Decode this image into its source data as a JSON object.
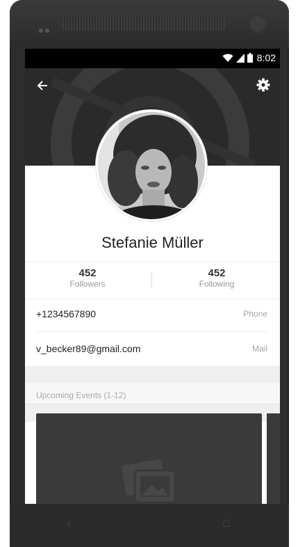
{
  "status_bar": {
    "time": "8:02"
  },
  "profile": {
    "name": "Stefanie Müller",
    "followers": {
      "count": "452",
      "label": "Followers"
    },
    "following": {
      "count": "452",
      "label": "Following"
    }
  },
  "contact": {
    "phone": {
      "value": "+1234567890",
      "type": "Phone"
    },
    "mail": {
      "value": "v_becker89@gmail.com",
      "type": "Mail"
    }
  },
  "events": {
    "title": "Upcoming Events (1-12)"
  },
  "icons": {
    "back": "arrow-left-icon",
    "settings": "gear-icon",
    "wifi": "wifi-icon",
    "signal": "signal-icon",
    "battery": "battery-icon",
    "image": "image-placeholder-icon"
  },
  "colors": {
    "cover": "#2a2a2a",
    "card": "#3a3a3a",
    "section_bg": "#efefef"
  }
}
